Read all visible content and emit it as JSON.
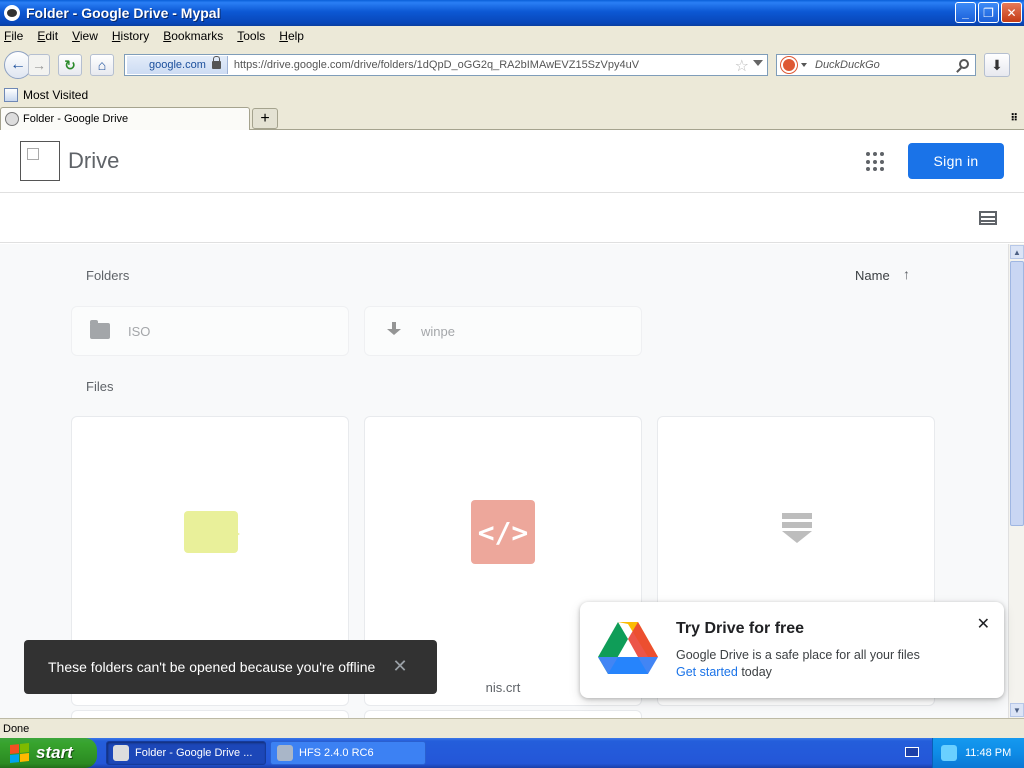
{
  "window": {
    "title": "Folder - Google Drive - Mypal",
    "buttons": [
      "_",
      "❐",
      "✕"
    ]
  },
  "menu": [
    "File",
    "Edit",
    "View",
    "History",
    "Bookmarks",
    "Tools",
    "Help"
  ],
  "nav": {
    "identity": "google.com",
    "url": "https://drive.google.com/drive/folders/1dQpD_oGG2q_RA2bIMAwEVZ15SzVpy4uV",
    "search_placeholder": "DuckDuckGo"
  },
  "bookmarks": {
    "most_visited": "Most Visited"
  },
  "tabs": [
    {
      "label": "Folder - Google Drive"
    }
  ],
  "drive": {
    "title": "Drive",
    "signin": "Sign in",
    "sections": {
      "folders": "Folders",
      "files": "Files"
    },
    "sort": {
      "label": "Name",
      "arrow": "↑"
    },
    "folders": [
      {
        "name": "ISO",
        "icon": "shared-folder-icon"
      },
      {
        "name": "winpe",
        "icon": "download-icon"
      }
    ],
    "files": [
      {
        "name": "",
        "icon": "email-file-icon"
      },
      {
        "name": "nis.crt",
        "icon": "code-file-icon"
      },
      {
        "name": "",
        "icon": "archive-file-icon"
      }
    ]
  },
  "toast": {
    "message": "These folders can't be opened because you're offline",
    "close": "✕"
  },
  "promo": {
    "title": "Try Drive for free",
    "text": "Google Drive is a safe place for all your files",
    "link": "Get started",
    "link_suffix": " today",
    "close": "✕"
  },
  "status": {
    "text": "Done"
  },
  "taskbar": {
    "start": "start",
    "tasks": [
      "Folder - Google Drive ...",
      "HFS 2.4.0 RC6"
    ],
    "clock": "11:48 PM"
  },
  "colors": {
    "accent": "#1a73e8",
    "xp_blue": "#245edb",
    "start_green": "#37a32d"
  }
}
